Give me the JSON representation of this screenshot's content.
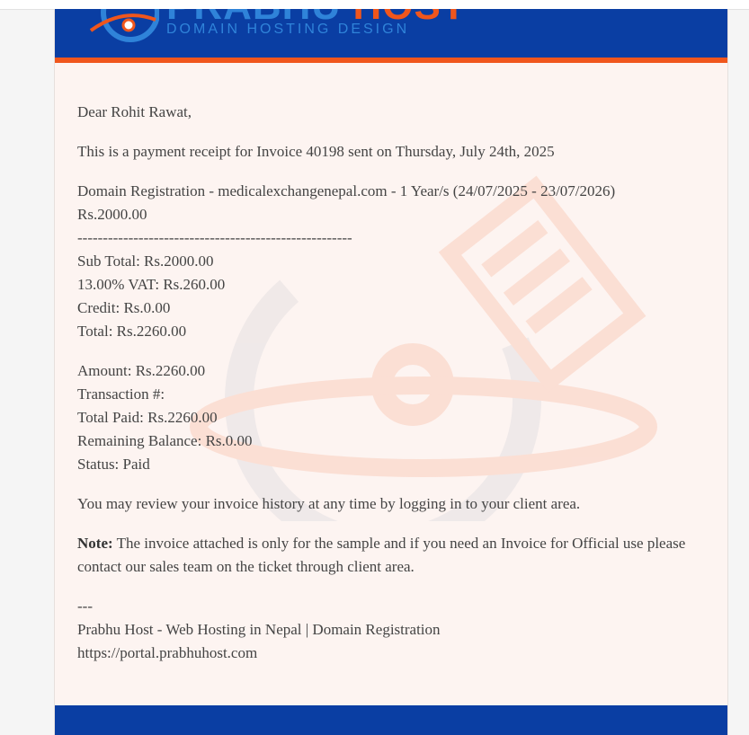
{
  "header": {
    "logo_name_1": "PRABHU",
    "logo_name_2": "HOST",
    "tagline": "DOMAIN HOSTING DESIGN"
  },
  "email": {
    "greeting": "Dear Rohit Rawat,",
    "intro": "This is a payment receipt for Invoice 40198 sent on Thursday, July 24th, 2025",
    "item_description": "Domain Registration - medicalexchangenepal.com - 1 Year/s (24/07/2025 - 23/07/2026)",
    "item_price": "Rs.2000.00",
    "separator": "------------------------------------------------------",
    "sub_total": "Sub Total: Rs.2000.00",
    "vat": "13.00% VAT: Rs.260.00",
    "credit": "Credit: Rs.0.00",
    "total": "Total: Rs.2260.00",
    "amount": "Amount: Rs.2260.00",
    "transaction": "Transaction #:",
    "total_paid": "Total Paid: Rs.2260.00",
    "remaining_balance": "Remaining Balance: Rs.0.00",
    "status": "Status: Paid",
    "review_text": "You may review your invoice history at any time by logging in to your client area.",
    "note_label": "Note:",
    "note_text": " The invoice attached is only for the sample and if you need an Invoice for Official use please contact our sales team on the ticket through client area.",
    "signature_dashes": "---",
    "signature_company": "Prabhu Host - Web Hosting in Nepal | Domain Registration",
    "signature_url": "https://portal.prabhuhost.com"
  },
  "footer": {
    "links": ""
  },
  "colors": {
    "header_bg": "#0a3ea3",
    "accent": "#f0561c",
    "card_bg": "#fdf4f1",
    "text": "#444444"
  }
}
